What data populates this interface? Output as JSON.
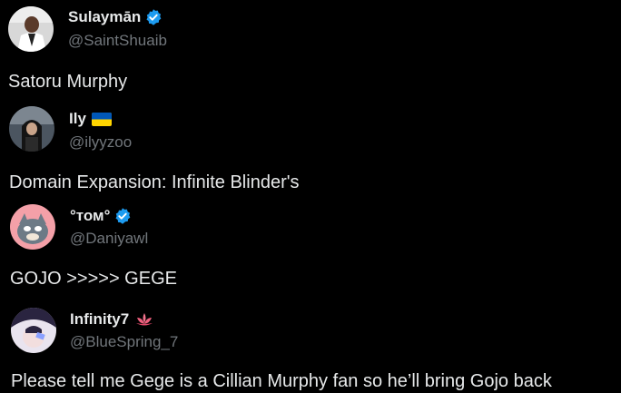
{
  "colors": {
    "background": "#000000",
    "primary_text": "#e7e9ea",
    "secondary_text": "#71767b",
    "verified_blue": "#1d9bf0"
  },
  "posts": [
    {
      "display_name": "Sulaymān",
      "handle": "@SaintShuaib",
      "badge": "verified-badge-icon",
      "text": "Satoru Murphy"
    },
    {
      "display_name": "Ily",
      "handle": "@ilyyzoo",
      "badge": "ukraine-flag-icon",
      "text": "Domain Expansion: Infinite Blinder's"
    },
    {
      "display_name": "°том°",
      "handle": "@Daniyawl",
      "badge": "verified-badge-icon",
      "text": "GOJO >>>>> GEGE"
    },
    {
      "display_name": "Infinity7",
      "handle": "@BlueSpring_7",
      "badge": "lotus-icon",
      "text": "Please tell me Gege is a Cillian Murphy fan so he’ll bring Gojo back"
    }
  ]
}
